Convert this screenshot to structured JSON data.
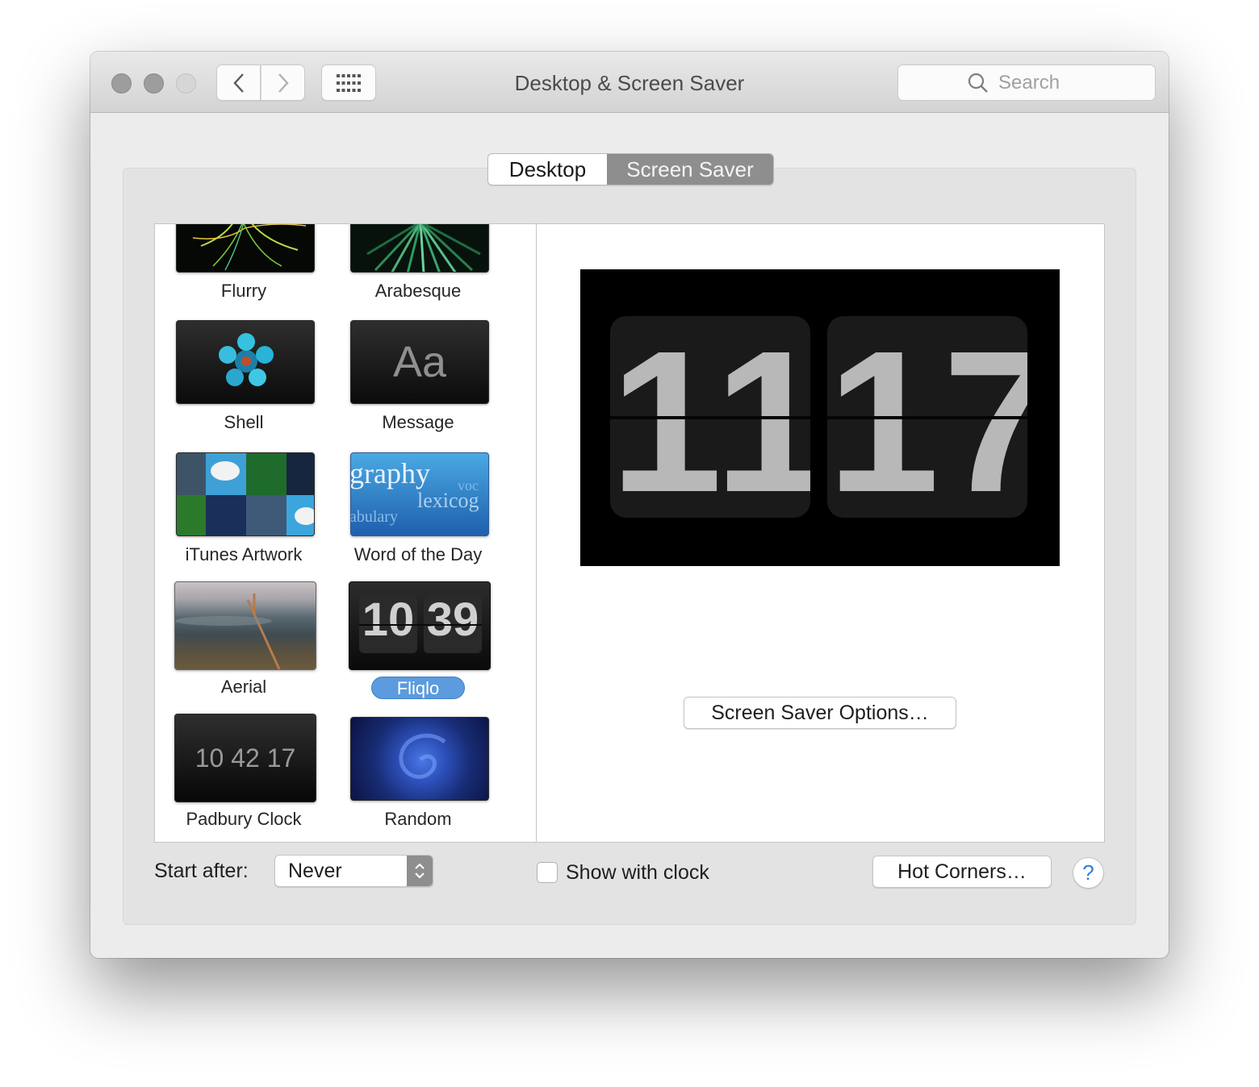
{
  "window": {
    "title": "Desktop & Screen Saver"
  },
  "toolbar": {
    "search_placeholder": "Search"
  },
  "tabs": [
    {
      "label": "Desktop",
      "selected": false
    },
    {
      "label": "Screen Saver",
      "selected": true
    }
  ],
  "screensavers": [
    {
      "label": "Flurry"
    },
    {
      "label": "Arabesque"
    },
    {
      "label": "Shell"
    },
    {
      "label": "Message",
      "thumb_text": "Aa"
    },
    {
      "label": "iTunes Artwork"
    },
    {
      "label": "Word of the Day",
      "thumb_words": [
        "graphy",
        "voc",
        "lexicog",
        "abulary"
      ]
    },
    {
      "label": "Aerial"
    },
    {
      "label": "Fliqlo",
      "thumb_hours": "10",
      "thumb_minutes": "39",
      "selected": true
    },
    {
      "label": "Padbury Clock",
      "thumb_time": "10 42 17"
    },
    {
      "label": "Random"
    }
  ],
  "preview": {
    "hours": "11",
    "minutes": "17"
  },
  "buttons": {
    "options": "Screen Saver Options…",
    "hot_corners": "Hot Corners…",
    "help": "?"
  },
  "start_after": {
    "label": "Start after:",
    "value": "Never"
  },
  "show_with_clock": {
    "label": "Show with clock",
    "checked": false
  },
  "colors": {
    "selection": "#5b9bde",
    "segment_selected": "#8e8e8e",
    "help": "#2f7ce0"
  }
}
